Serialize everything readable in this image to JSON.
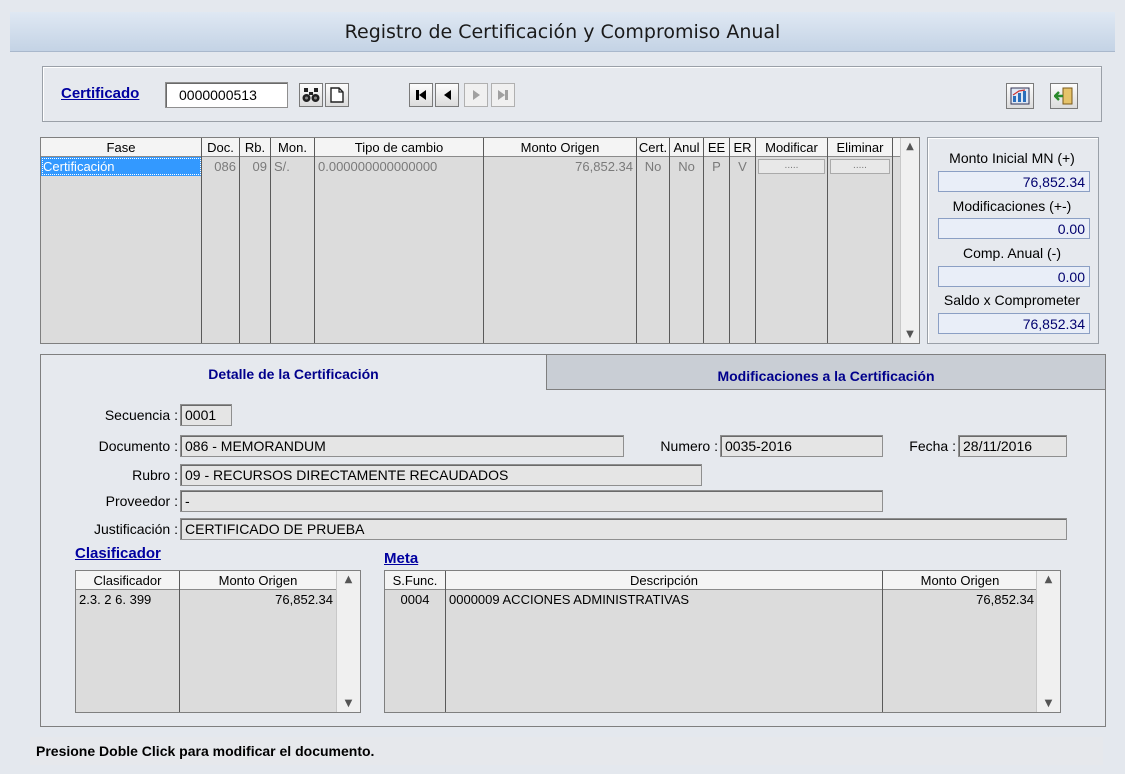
{
  "window": {
    "title": "Registro de Certificación y Compromiso Anual"
  },
  "toolbar": {
    "certificado_label": "Certificado",
    "certificado_value": "0000000513"
  },
  "fases_grid": {
    "headers": [
      "Fase",
      "Doc.",
      "Rb.",
      "Mon.",
      "Tipo de cambio",
      "Monto Origen",
      "Cert.",
      "Anul",
      "EE",
      "ER",
      "Modificar",
      "Eliminar"
    ],
    "rows": [
      {
        "fase": "Certificación",
        "doc": "086",
        "rb": "09",
        "mon": "S/.",
        "tipo_cambio": "0.000000000000000",
        "monto_origen": "76,852.34",
        "cert": "No",
        "anul": "No",
        "ee": "P",
        "er": "V",
        "modificar": ".....",
        "eliminar": "....."
      }
    ]
  },
  "summary": {
    "monto_inicial_label": "Monto Inicial MN (+)",
    "monto_inicial_value": "76,852.34",
    "modificaciones_label": "Modificaciones (+-)",
    "modificaciones_value": "0.00",
    "comp_anual_label": "Comp. Anual (-)",
    "comp_anual_value": "0.00",
    "saldo_label": "Saldo x Comprometer",
    "saldo_value": "76,852.34"
  },
  "tabs": [
    {
      "label": "Detalle de la Certificación",
      "active": true
    },
    {
      "label": "Modificaciones a la Certificación",
      "active": false
    }
  ],
  "detalle": {
    "secuencia_label": "Secuencia :",
    "secuencia_value": "0001",
    "documento_label": "Documento :",
    "documento_value": "086 - MEMORANDUM",
    "numero_label": "Numero :",
    "numero_value": "0035-2016",
    "fecha_label": "Fecha :",
    "fecha_value": "28/11/2016",
    "rubro_label": "Rubro :",
    "rubro_value": "09 - RECURSOS DIRECTAMENTE RECAUDADOS",
    "proveedor_label": "Proveedor :",
    "proveedor_value": "-",
    "justificacion_label": "Justificación :",
    "justificacion_value": "CERTIFICADO DE PRUEBA"
  },
  "clasificador": {
    "title": "Clasificador",
    "headers": [
      "Clasificador",
      "Monto Origen"
    ],
    "rows": [
      {
        "clasificador": "2.3. 2 6. 399",
        "monto": "76,852.34"
      }
    ]
  },
  "meta": {
    "title": "Meta",
    "headers": [
      "S.Func.",
      "Descripción",
      "Monto Origen"
    ],
    "rows": [
      {
        "sfunc": "0004",
        "descripcion": "0000009  ACCIONES ADMINISTRATIVAS",
        "monto": "76,852.34"
      }
    ]
  },
  "status": {
    "message": "Presione Doble Click para modificar el documento."
  },
  "colors": {
    "selection": "#3399ff",
    "link": "#0000a0",
    "summary_value": "#00006e"
  }
}
